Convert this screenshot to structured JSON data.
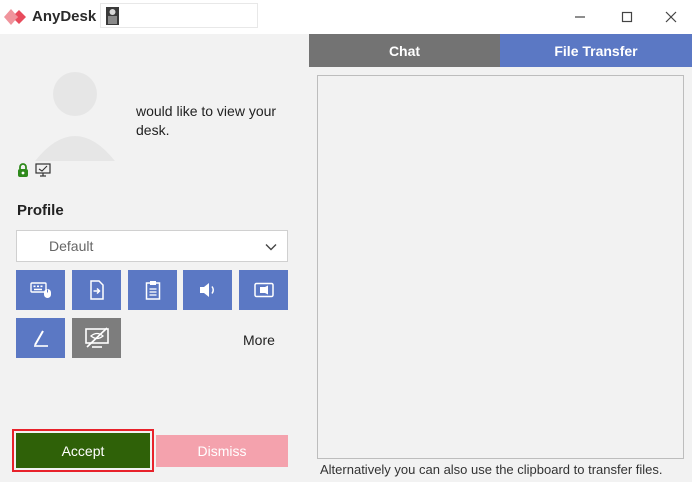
{
  "window": {
    "app_title": "AnyDesk",
    "brand_color": "#e84b5c",
    "controls": [
      "minimize-icon",
      "maximize-icon",
      "close-icon"
    ]
  },
  "request": {
    "message": "would like to view your desk.",
    "status_icons": [
      "lock-icon",
      "monitor-icon"
    ]
  },
  "profile": {
    "label": "Profile",
    "selected": "Default"
  },
  "permissions": {
    "buttons": [
      {
        "name": "keyboard-mouse-icon",
        "enabled": true
      },
      {
        "name": "file-transfer-icon",
        "enabled": true
      },
      {
        "name": "clipboard-icon",
        "enabled": true
      },
      {
        "name": "sound-icon",
        "enabled": true
      },
      {
        "name": "recording-icon",
        "enabled": true
      },
      {
        "name": "draw-icon",
        "enabled": true
      },
      {
        "name": "privacy-screen-icon",
        "enabled": false
      }
    ],
    "more_label": "More",
    "enabled_color": "#5b78c4",
    "disabled_color": "#7d7d7d"
  },
  "actions": {
    "accept_label": "Accept",
    "dismiss_label": "Dismiss",
    "accept_color": "#2f6108",
    "dismiss_color": "#f4a2ad",
    "highlight_color": "#e8222b"
  },
  "tabs": {
    "chat_label": "Chat",
    "file_transfer_label": "File Transfer",
    "active": "File Transfer"
  },
  "file_transfer": {
    "hint": "Alternatively you can also use the clipboard to transfer files."
  }
}
